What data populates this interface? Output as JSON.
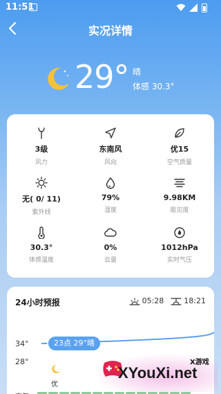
{
  "status_bar": {
    "time": "11:51"
  },
  "title_bar": {
    "title": "实况详情"
  },
  "hero": {
    "temperature": "29°",
    "condition": "晴",
    "feels_like": "体感 30.3°"
  },
  "details": [
    {
      "icon": "wind-power-icon",
      "value": "3级",
      "label": "风力"
    },
    {
      "icon": "wind-direction-icon",
      "value": "东南风",
      "label": "风向"
    },
    {
      "icon": "leaf-icon",
      "value": "优15",
      "label": "空气质量"
    },
    {
      "icon": "sun-uv-icon",
      "value": "无( 0/ 11)",
      "label": "紫外线"
    },
    {
      "icon": "humidity-drop-icon",
      "value": "79%",
      "label": "湿度"
    },
    {
      "icon": "visibility-icon",
      "value": "9.98KM",
      "label": "能见度"
    },
    {
      "icon": "thermometer-icon",
      "value": "30.3°",
      "label": "体感温度"
    },
    {
      "icon": "cloud-icon",
      "value": "0%",
      "label": "云量"
    },
    {
      "icon": "pressure-icon",
      "value": "1012hPa",
      "label": "实时气压"
    }
  ],
  "forecast": {
    "title": "24小时预报",
    "sunrise": "05:28",
    "sunset": "18:21",
    "y_labels": [
      "34°",
      "28°"
    ],
    "tooltip": "23点 29°晴",
    "aqi_text": "优",
    "cutoff_label": "空气"
  },
  "watermark": {
    "text": "XYouXi.net",
    "small": "X游戏"
  },
  "colors": {
    "accent": "#4c9cf0",
    "tooltip": "#5aa2f0",
    "aqi_good": "#84cf9a"
  }
}
